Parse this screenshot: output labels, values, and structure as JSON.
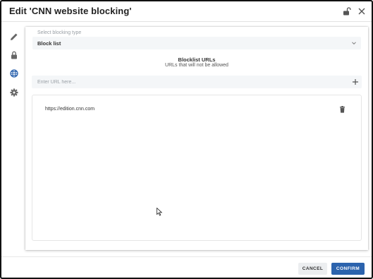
{
  "dialog": {
    "title": "Edit 'CNN website blocking'",
    "icons": {
      "lock": "lock-open-icon",
      "close": "close-icon"
    }
  },
  "sidebar": {
    "items": [
      {
        "icon": "pencil-icon",
        "active": false
      },
      {
        "icon": "lock-icon",
        "active": false
      },
      {
        "icon": "globe-icon",
        "active": true
      },
      {
        "icon": "gear-icon",
        "active": false
      }
    ]
  },
  "blocking": {
    "type_label": "Select blocking type",
    "type_value": "Block list",
    "list_title": "Blocklist URLs",
    "list_subtitle": "URLs that will not be allowed",
    "url_placeholder": "Enter URL here...",
    "urls": [
      "https://edition.cnn.com"
    ]
  },
  "footer": {
    "cancel_label": "CANCEL",
    "confirm_label": "CONFIRM"
  },
  "colors": {
    "primary": "#2c63ad",
    "active_icon": "#2c63ad",
    "icon": "#666666",
    "field_bg": "#f4f6f8"
  }
}
